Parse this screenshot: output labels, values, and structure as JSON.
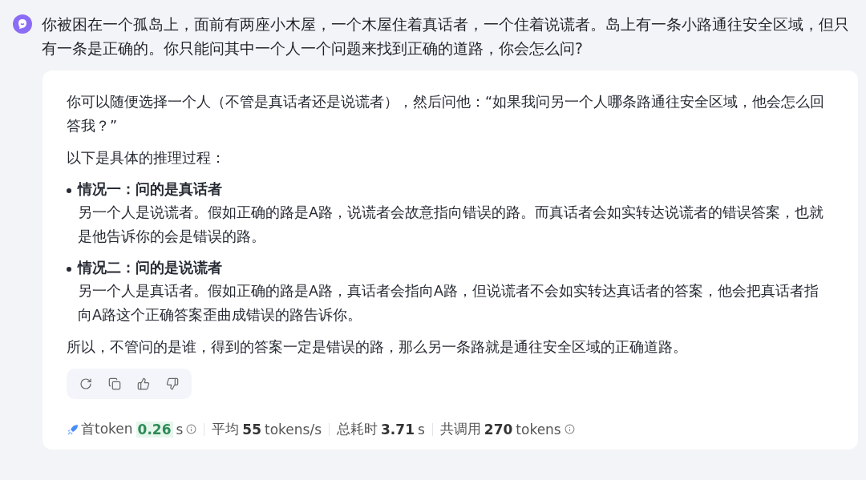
{
  "question": "你被困在一个孤岛上，面前有两座小木屋，一个木屋住着真话者，一个住着说谎者。岛上有一条小路通往安全区域，但只有一条是正确的。你只能问其中一个人一个问题来找到正确的道路，你会怎么问?",
  "answer": [
    {
      "kind": "paragraph",
      "text": "你可以随便选择一个人（不管是真话者还是说谎者），然后问他：“如果我问另一个人哪条路通往安全区域，他会怎么回答我？”"
    },
    {
      "kind": "paragraph",
      "text": "以下是具体的推理过程："
    },
    {
      "kind": "bullet",
      "title": "情况一：问的是真话者",
      "text": "另一个人是说谎者。假如正确的路是A路，说谎者会故意指向错误的路。而真话者会如实转达说谎者的错误答案，也就是他告诉你的会是错误的路。"
    },
    {
      "kind": "bullet",
      "title": "情况二：问的是说谎者",
      "text": "另一个人是真话者。假如正确的路是A路，真话者会指向A路，但说谎者不会如实转达真话者的答案，他会把真话者指向A路这个正确答案歪曲成错误的路告诉你。"
    },
    {
      "kind": "paragraph",
      "text": "所以，不管问的是谁，得到的答案一定是错误的路，那么另一条路就是通往安全区域的正确道路。"
    }
  ],
  "actions": [
    {
      "kind": "refresh"
    },
    {
      "kind": "copy"
    },
    {
      "kind": "like"
    },
    {
      "kind": "dislike"
    }
  ],
  "stats": [
    {
      "label": "首token",
      "value": "0.26",
      "unit": "s",
      "highlighted": true,
      "info": true
    },
    {
      "label": "平均",
      "value": "55",
      "unit": "tokens/s",
      "highlighted": false,
      "info": false
    },
    {
      "label": "总耗时",
      "value": "3.71",
      "unit": "s",
      "highlighted": false,
      "info": false
    },
    {
      "label": "共调用",
      "value": "270",
      "unit": "tokens",
      "highlighted": false,
      "info": true
    }
  ]
}
